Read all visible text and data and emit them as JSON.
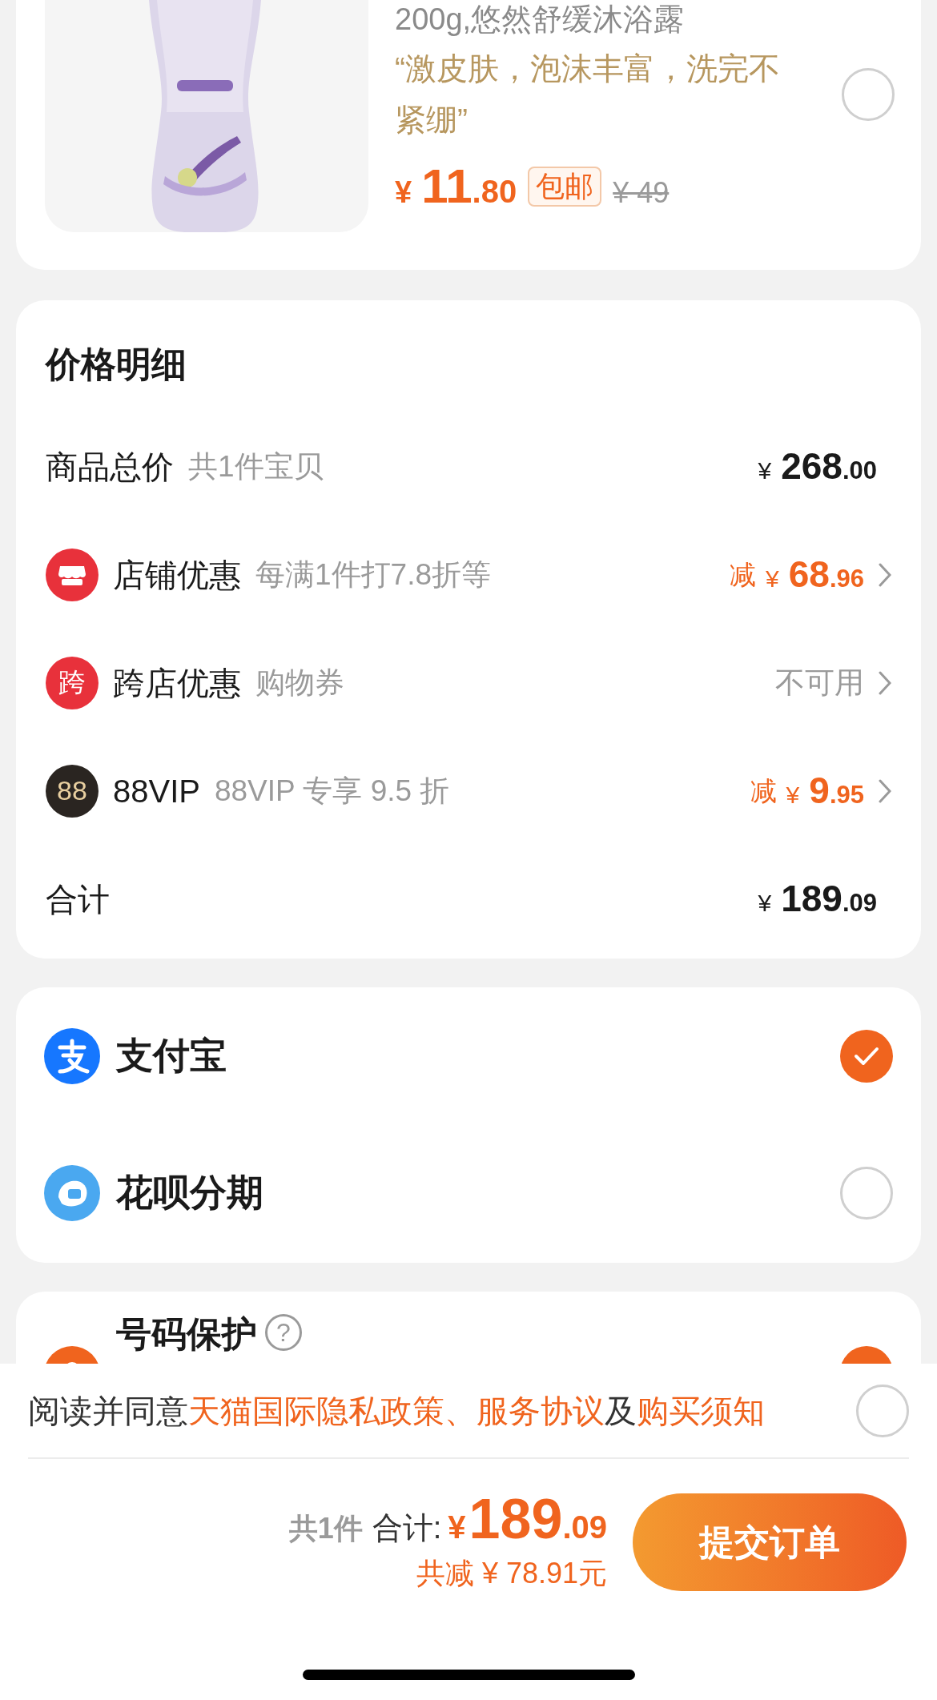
{
  "product": {
    "title": "200g,悠然舒缓沐浴露",
    "review": "“激皮肤，泡沫丰富，洗完不紧绷”",
    "price": {
      "symbol": "¥",
      "int": "11",
      "dec": ".80"
    },
    "badge": "包邮",
    "original_price": "¥ 49",
    "selected": false
  },
  "price_details": {
    "title": "价格明细",
    "rows": [
      {
        "kind": "total",
        "label": "商品总价",
        "note": "共1件宝贝",
        "symbol": "¥",
        "int": "268",
        "dec": ".00"
      },
      {
        "kind": "shop",
        "label": "店铺优惠",
        "note": "每满1件打7.8折等",
        "prefix": "减",
        "symbol": "¥",
        "int": "68",
        "dec": ".96"
      },
      {
        "kind": "crossshop",
        "icon_text": "跨",
        "label": "跨店优惠",
        "note": "购物券",
        "status": "不可用"
      },
      {
        "kind": "vip",
        "icon_text": "88",
        "label": "88VIP",
        "note": "88VIP 专享 9.5 折",
        "prefix": "减",
        "symbol": "¥",
        "int": "9",
        "dec": ".95"
      },
      {
        "kind": "total",
        "label": "合计",
        "symbol": "¥",
        "int": "189",
        "dec": ".09"
      }
    ]
  },
  "payment_methods": [
    {
      "label": "支付宝",
      "selected": true
    },
    {
      "label": "花呗分期",
      "selected": false
    }
  ],
  "number_protection": {
    "label": "号码保护",
    "help": "?",
    "on": true
  },
  "agreement": {
    "parts": [
      {
        "kind": "text",
        "text": "阅读并同意"
      },
      {
        "kind": "link",
        "text": "天猫国际隐私政策"
      },
      {
        "kind": "separator",
        "text": "、"
      },
      {
        "kind": "link",
        "text": "服务协议"
      },
      {
        "kind": "text",
        "text": "及"
      },
      {
        "kind": "link",
        "text": "购买须知"
      }
    ],
    "checked": false
  },
  "footer": {
    "count": "共1件",
    "total_label": "合计:",
    "symbol": "¥",
    "int": "189",
    "dec": ".09",
    "saved": "共减 ¥ 78.91元",
    "submit": "提交订单"
  }
}
